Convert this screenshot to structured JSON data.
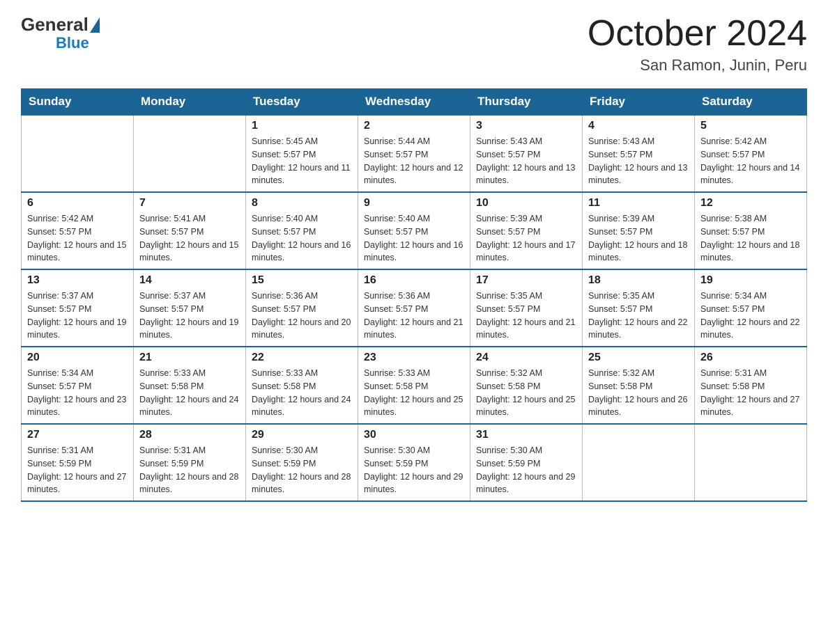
{
  "header": {
    "title": "October 2024",
    "location": "San Ramon, Junin, Peru",
    "logo_general": "General",
    "logo_blue": "Blue"
  },
  "weekdays": [
    "Sunday",
    "Monday",
    "Tuesday",
    "Wednesday",
    "Thursday",
    "Friday",
    "Saturday"
  ],
  "weeks": [
    [
      {
        "day": "",
        "sunrise": "",
        "sunset": "",
        "daylight": ""
      },
      {
        "day": "",
        "sunrise": "",
        "sunset": "",
        "daylight": ""
      },
      {
        "day": "1",
        "sunrise": "Sunrise: 5:45 AM",
        "sunset": "Sunset: 5:57 PM",
        "daylight": "Daylight: 12 hours and 11 minutes."
      },
      {
        "day": "2",
        "sunrise": "Sunrise: 5:44 AM",
        "sunset": "Sunset: 5:57 PM",
        "daylight": "Daylight: 12 hours and 12 minutes."
      },
      {
        "day": "3",
        "sunrise": "Sunrise: 5:43 AM",
        "sunset": "Sunset: 5:57 PM",
        "daylight": "Daylight: 12 hours and 13 minutes."
      },
      {
        "day": "4",
        "sunrise": "Sunrise: 5:43 AM",
        "sunset": "Sunset: 5:57 PM",
        "daylight": "Daylight: 12 hours and 13 minutes."
      },
      {
        "day": "5",
        "sunrise": "Sunrise: 5:42 AM",
        "sunset": "Sunset: 5:57 PM",
        "daylight": "Daylight: 12 hours and 14 minutes."
      }
    ],
    [
      {
        "day": "6",
        "sunrise": "Sunrise: 5:42 AM",
        "sunset": "Sunset: 5:57 PM",
        "daylight": "Daylight: 12 hours and 15 minutes."
      },
      {
        "day": "7",
        "sunrise": "Sunrise: 5:41 AM",
        "sunset": "Sunset: 5:57 PM",
        "daylight": "Daylight: 12 hours and 15 minutes."
      },
      {
        "day": "8",
        "sunrise": "Sunrise: 5:40 AM",
        "sunset": "Sunset: 5:57 PM",
        "daylight": "Daylight: 12 hours and 16 minutes."
      },
      {
        "day": "9",
        "sunrise": "Sunrise: 5:40 AM",
        "sunset": "Sunset: 5:57 PM",
        "daylight": "Daylight: 12 hours and 16 minutes."
      },
      {
        "day": "10",
        "sunrise": "Sunrise: 5:39 AM",
        "sunset": "Sunset: 5:57 PM",
        "daylight": "Daylight: 12 hours and 17 minutes."
      },
      {
        "day": "11",
        "sunrise": "Sunrise: 5:39 AM",
        "sunset": "Sunset: 5:57 PM",
        "daylight": "Daylight: 12 hours and 18 minutes."
      },
      {
        "day": "12",
        "sunrise": "Sunrise: 5:38 AM",
        "sunset": "Sunset: 5:57 PM",
        "daylight": "Daylight: 12 hours and 18 minutes."
      }
    ],
    [
      {
        "day": "13",
        "sunrise": "Sunrise: 5:37 AM",
        "sunset": "Sunset: 5:57 PM",
        "daylight": "Daylight: 12 hours and 19 minutes."
      },
      {
        "day": "14",
        "sunrise": "Sunrise: 5:37 AM",
        "sunset": "Sunset: 5:57 PM",
        "daylight": "Daylight: 12 hours and 19 minutes."
      },
      {
        "day": "15",
        "sunrise": "Sunrise: 5:36 AM",
        "sunset": "Sunset: 5:57 PM",
        "daylight": "Daylight: 12 hours and 20 minutes."
      },
      {
        "day": "16",
        "sunrise": "Sunrise: 5:36 AM",
        "sunset": "Sunset: 5:57 PM",
        "daylight": "Daylight: 12 hours and 21 minutes."
      },
      {
        "day": "17",
        "sunrise": "Sunrise: 5:35 AM",
        "sunset": "Sunset: 5:57 PM",
        "daylight": "Daylight: 12 hours and 21 minutes."
      },
      {
        "day": "18",
        "sunrise": "Sunrise: 5:35 AM",
        "sunset": "Sunset: 5:57 PM",
        "daylight": "Daylight: 12 hours and 22 minutes."
      },
      {
        "day": "19",
        "sunrise": "Sunrise: 5:34 AM",
        "sunset": "Sunset: 5:57 PM",
        "daylight": "Daylight: 12 hours and 22 minutes."
      }
    ],
    [
      {
        "day": "20",
        "sunrise": "Sunrise: 5:34 AM",
        "sunset": "Sunset: 5:57 PM",
        "daylight": "Daylight: 12 hours and 23 minutes."
      },
      {
        "day": "21",
        "sunrise": "Sunrise: 5:33 AM",
        "sunset": "Sunset: 5:58 PM",
        "daylight": "Daylight: 12 hours and 24 minutes."
      },
      {
        "day": "22",
        "sunrise": "Sunrise: 5:33 AM",
        "sunset": "Sunset: 5:58 PM",
        "daylight": "Daylight: 12 hours and 24 minutes."
      },
      {
        "day": "23",
        "sunrise": "Sunrise: 5:33 AM",
        "sunset": "Sunset: 5:58 PM",
        "daylight": "Daylight: 12 hours and 25 minutes."
      },
      {
        "day": "24",
        "sunrise": "Sunrise: 5:32 AM",
        "sunset": "Sunset: 5:58 PM",
        "daylight": "Daylight: 12 hours and 25 minutes."
      },
      {
        "day": "25",
        "sunrise": "Sunrise: 5:32 AM",
        "sunset": "Sunset: 5:58 PM",
        "daylight": "Daylight: 12 hours and 26 minutes."
      },
      {
        "day": "26",
        "sunrise": "Sunrise: 5:31 AM",
        "sunset": "Sunset: 5:58 PM",
        "daylight": "Daylight: 12 hours and 27 minutes."
      }
    ],
    [
      {
        "day": "27",
        "sunrise": "Sunrise: 5:31 AM",
        "sunset": "Sunset: 5:59 PM",
        "daylight": "Daylight: 12 hours and 27 minutes."
      },
      {
        "day": "28",
        "sunrise": "Sunrise: 5:31 AM",
        "sunset": "Sunset: 5:59 PM",
        "daylight": "Daylight: 12 hours and 28 minutes."
      },
      {
        "day": "29",
        "sunrise": "Sunrise: 5:30 AM",
        "sunset": "Sunset: 5:59 PM",
        "daylight": "Daylight: 12 hours and 28 minutes."
      },
      {
        "day": "30",
        "sunrise": "Sunrise: 5:30 AM",
        "sunset": "Sunset: 5:59 PM",
        "daylight": "Daylight: 12 hours and 29 minutes."
      },
      {
        "day": "31",
        "sunrise": "Sunrise: 5:30 AM",
        "sunset": "Sunset: 5:59 PM",
        "daylight": "Daylight: 12 hours and 29 minutes."
      },
      {
        "day": "",
        "sunrise": "",
        "sunset": "",
        "daylight": ""
      },
      {
        "day": "",
        "sunrise": "",
        "sunset": "",
        "daylight": ""
      }
    ]
  ]
}
